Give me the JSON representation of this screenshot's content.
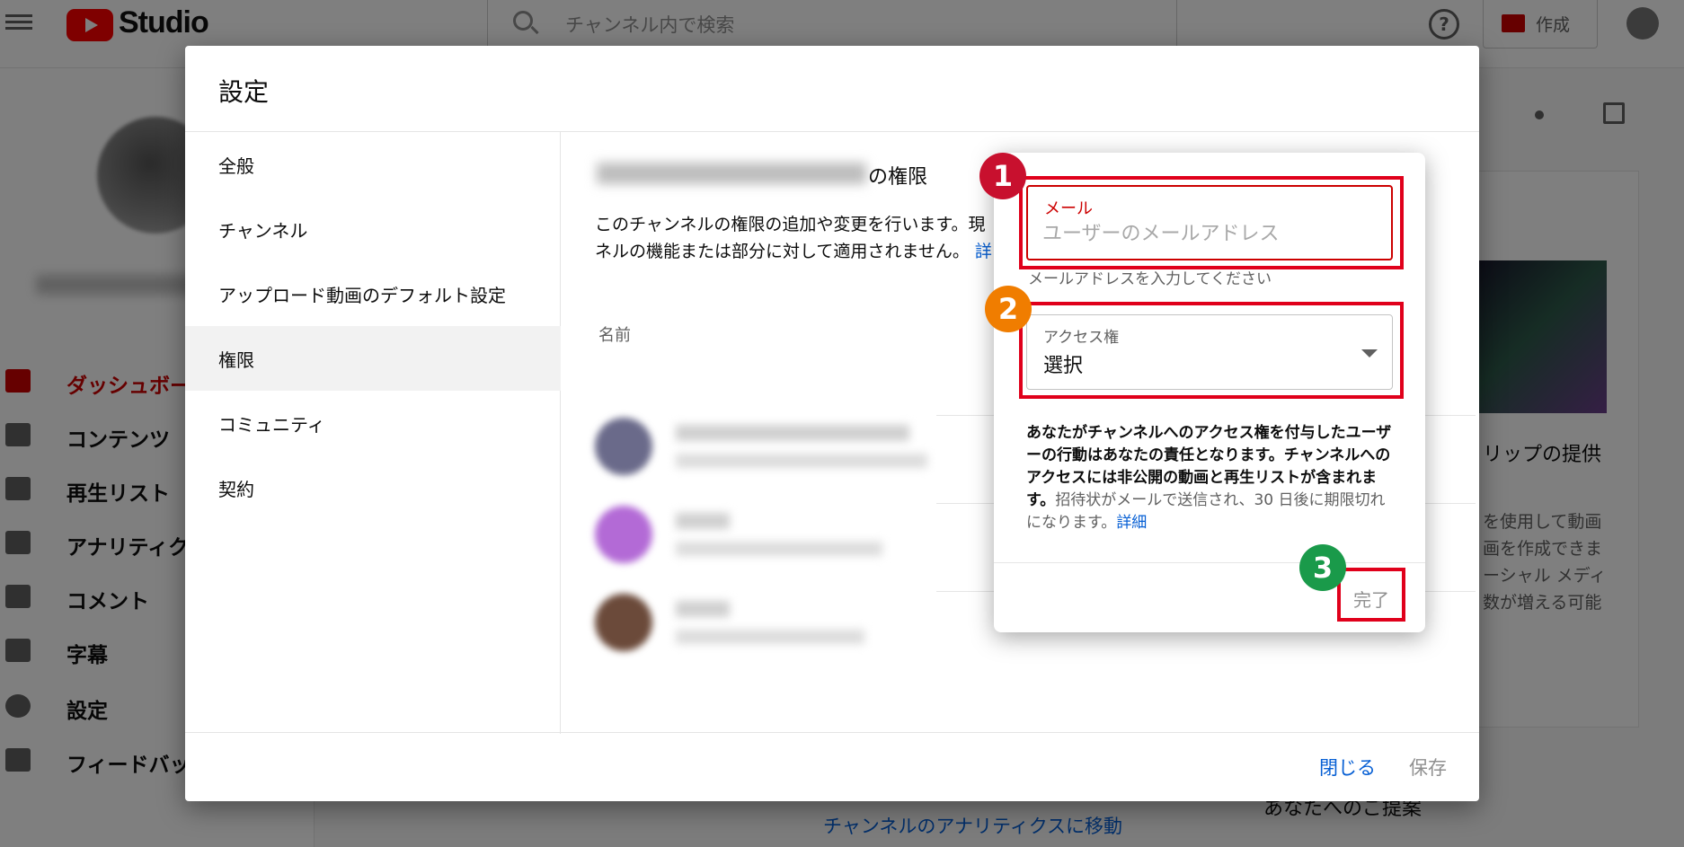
{
  "topbar": {
    "brand": "Studio",
    "search_placeholder": "チャンネル内で検索",
    "help_icon": "?",
    "create_label": "作成"
  },
  "sidebar": {
    "items": [
      {
        "label": "ダッシュボード",
        "icon": "dashboard-icon"
      },
      {
        "label": "コンテンツ",
        "icon": "content-icon"
      },
      {
        "label": "再生リスト",
        "icon": "playlist-icon"
      },
      {
        "label": "アナリティクス",
        "icon": "analytics-icon"
      },
      {
        "label": "コメント",
        "icon": "comment-icon"
      },
      {
        "label": "字幕",
        "icon": "subtitles-icon"
      },
      {
        "label": "設定",
        "icon": "gear-icon"
      },
      {
        "label": "フィードバックを送信",
        "icon": "feedback-icon"
      }
    ]
  },
  "background": {
    "card_title": "リップの提供",
    "card_lines": [
      "を使用して動画",
      "画を作成できま",
      "ーシャル メディ",
      "数が増える可能"
    ],
    "analytics_link": "チャンネルのアナリティクスに移動",
    "suggestion_title": "あなたへのご提案"
  },
  "dialog": {
    "title": "設定",
    "nav": [
      {
        "label": "全般"
      },
      {
        "label": "チャンネル"
      },
      {
        "label": "アップロード動画のデフォルト設定"
      },
      {
        "label": "権限"
      },
      {
        "label": "コミュニティ"
      },
      {
        "label": "契約"
      }
    ],
    "selected_nav": "権限",
    "permissions": {
      "title_suffix": "の権限",
      "desc_line1": "このチャンネルの権限の追加や変更を行います。現",
      "desc_line2": "ネルの機能または部分に対して適用されません。",
      "desc_link": "詳",
      "column_name": "名前"
    },
    "footer": {
      "close_label": "閉じる",
      "save_label": "保存"
    }
  },
  "invite": {
    "email_label": "メール",
    "email_placeholder": "ユーザーのメールアドレス",
    "email_hint": "メールアドレスを入力してください",
    "access_label": "アクセス権",
    "access_value": "選択",
    "notice_bold": "あなたがチャンネルへのアクセス権を付与したユーザーの行動はあなたの責任となります。チャンネルへのアクセスには非公開の動画と再生リストが含まれます。",
    "notice_rest": "招待状がメールで送信され、30 日後に期限切れになります。",
    "notice_link": "詳細",
    "done_label": "完了"
  },
  "annotations": {
    "steps": [
      "1",
      "2",
      "3"
    ],
    "colors": {
      "step1": "#c8102e",
      "step2": "#f07d00",
      "step3": "#1a9a4a",
      "highlight": "#e0001b"
    }
  }
}
